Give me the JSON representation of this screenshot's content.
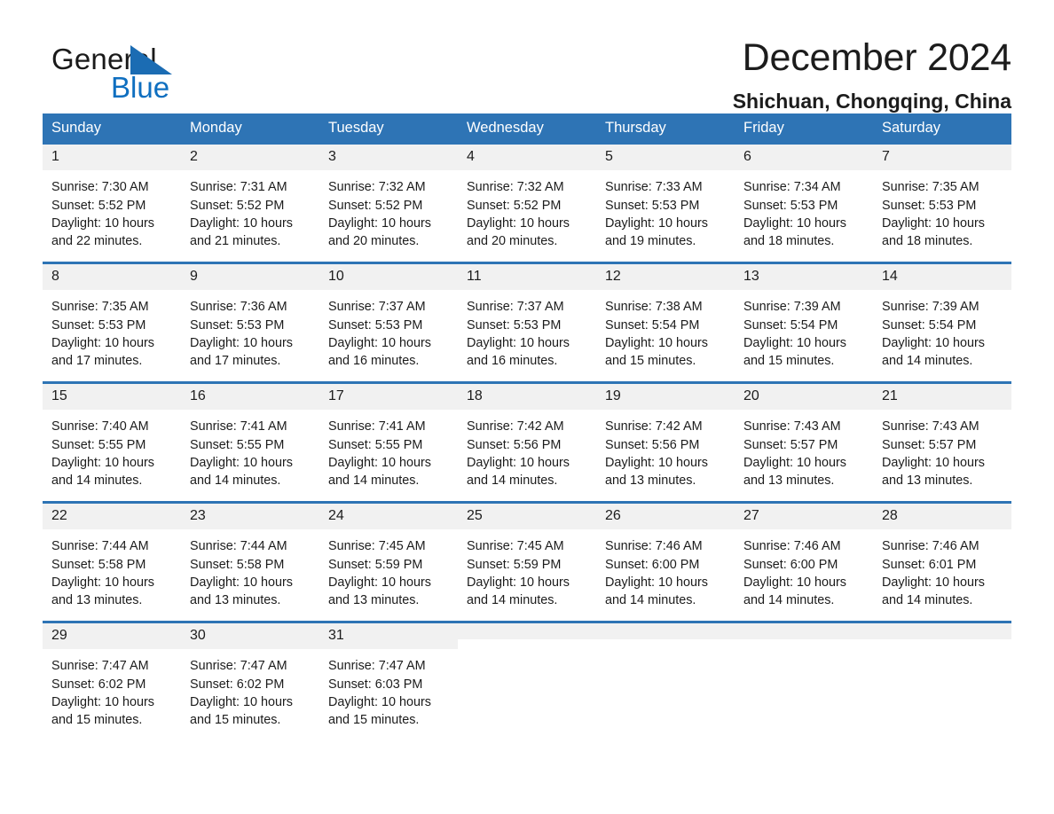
{
  "brand": {
    "name_part1": "General",
    "name_part2": "Blue",
    "triangle_color": "#1b6cb3",
    "blue_color": "#0f6fc0"
  },
  "header": {
    "title": "December 2024",
    "subtitle": "Shichuan, Chongqing, China"
  },
  "theme": {
    "header_bg": "#2e74b5",
    "daynum_bg": "#f1f1f1",
    "text": "#1c1c1c"
  },
  "weekday_headers": [
    "Sunday",
    "Monday",
    "Tuesday",
    "Wednesday",
    "Thursday",
    "Friday",
    "Saturday"
  ],
  "weeks": [
    [
      {
        "day": "1",
        "sunrise": "Sunrise: 7:30 AM",
        "sunset": "Sunset: 5:52 PM",
        "daylight1": "Daylight: 10 hours",
        "daylight2": "and 22 minutes."
      },
      {
        "day": "2",
        "sunrise": "Sunrise: 7:31 AM",
        "sunset": "Sunset: 5:52 PM",
        "daylight1": "Daylight: 10 hours",
        "daylight2": "and 21 minutes."
      },
      {
        "day": "3",
        "sunrise": "Sunrise: 7:32 AM",
        "sunset": "Sunset: 5:52 PM",
        "daylight1": "Daylight: 10 hours",
        "daylight2": "and 20 minutes."
      },
      {
        "day": "4",
        "sunrise": "Sunrise: 7:32 AM",
        "sunset": "Sunset: 5:52 PM",
        "daylight1": "Daylight: 10 hours",
        "daylight2": "and 20 minutes."
      },
      {
        "day": "5",
        "sunrise": "Sunrise: 7:33 AM",
        "sunset": "Sunset: 5:53 PM",
        "daylight1": "Daylight: 10 hours",
        "daylight2": "and 19 minutes."
      },
      {
        "day": "6",
        "sunrise": "Sunrise: 7:34 AM",
        "sunset": "Sunset: 5:53 PM",
        "daylight1": "Daylight: 10 hours",
        "daylight2": "and 18 minutes."
      },
      {
        "day": "7",
        "sunrise": "Sunrise: 7:35 AM",
        "sunset": "Sunset: 5:53 PM",
        "daylight1": "Daylight: 10 hours",
        "daylight2": "and 18 minutes."
      }
    ],
    [
      {
        "day": "8",
        "sunrise": "Sunrise: 7:35 AM",
        "sunset": "Sunset: 5:53 PM",
        "daylight1": "Daylight: 10 hours",
        "daylight2": "and 17 minutes."
      },
      {
        "day": "9",
        "sunrise": "Sunrise: 7:36 AM",
        "sunset": "Sunset: 5:53 PM",
        "daylight1": "Daylight: 10 hours",
        "daylight2": "and 17 minutes."
      },
      {
        "day": "10",
        "sunrise": "Sunrise: 7:37 AM",
        "sunset": "Sunset: 5:53 PM",
        "daylight1": "Daylight: 10 hours",
        "daylight2": "and 16 minutes."
      },
      {
        "day": "11",
        "sunrise": "Sunrise: 7:37 AM",
        "sunset": "Sunset: 5:53 PM",
        "daylight1": "Daylight: 10 hours",
        "daylight2": "and 16 minutes."
      },
      {
        "day": "12",
        "sunrise": "Sunrise: 7:38 AM",
        "sunset": "Sunset: 5:54 PM",
        "daylight1": "Daylight: 10 hours",
        "daylight2": "and 15 minutes."
      },
      {
        "day": "13",
        "sunrise": "Sunrise: 7:39 AM",
        "sunset": "Sunset: 5:54 PM",
        "daylight1": "Daylight: 10 hours",
        "daylight2": "and 15 minutes."
      },
      {
        "day": "14",
        "sunrise": "Sunrise: 7:39 AM",
        "sunset": "Sunset: 5:54 PM",
        "daylight1": "Daylight: 10 hours",
        "daylight2": "and 14 minutes."
      }
    ],
    [
      {
        "day": "15",
        "sunrise": "Sunrise: 7:40 AM",
        "sunset": "Sunset: 5:55 PM",
        "daylight1": "Daylight: 10 hours",
        "daylight2": "and 14 minutes."
      },
      {
        "day": "16",
        "sunrise": "Sunrise: 7:41 AM",
        "sunset": "Sunset: 5:55 PM",
        "daylight1": "Daylight: 10 hours",
        "daylight2": "and 14 minutes."
      },
      {
        "day": "17",
        "sunrise": "Sunrise: 7:41 AM",
        "sunset": "Sunset: 5:55 PM",
        "daylight1": "Daylight: 10 hours",
        "daylight2": "and 14 minutes."
      },
      {
        "day": "18",
        "sunrise": "Sunrise: 7:42 AM",
        "sunset": "Sunset: 5:56 PM",
        "daylight1": "Daylight: 10 hours",
        "daylight2": "and 14 minutes."
      },
      {
        "day": "19",
        "sunrise": "Sunrise: 7:42 AM",
        "sunset": "Sunset: 5:56 PM",
        "daylight1": "Daylight: 10 hours",
        "daylight2": "and 13 minutes."
      },
      {
        "day": "20",
        "sunrise": "Sunrise: 7:43 AM",
        "sunset": "Sunset: 5:57 PM",
        "daylight1": "Daylight: 10 hours",
        "daylight2": "and 13 minutes."
      },
      {
        "day": "21",
        "sunrise": "Sunrise: 7:43 AM",
        "sunset": "Sunset: 5:57 PM",
        "daylight1": "Daylight: 10 hours",
        "daylight2": "and 13 minutes."
      }
    ],
    [
      {
        "day": "22",
        "sunrise": "Sunrise: 7:44 AM",
        "sunset": "Sunset: 5:58 PM",
        "daylight1": "Daylight: 10 hours",
        "daylight2": "and 13 minutes."
      },
      {
        "day": "23",
        "sunrise": "Sunrise: 7:44 AM",
        "sunset": "Sunset: 5:58 PM",
        "daylight1": "Daylight: 10 hours",
        "daylight2": "and 13 minutes."
      },
      {
        "day": "24",
        "sunrise": "Sunrise: 7:45 AM",
        "sunset": "Sunset: 5:59 PM",
        "daylight1": "Daylight: 10 hours",
        "daylight2": "and 13 minutes."
      },
      {
        "day": "25",
        "sunrise": "Sunrise: 7:45 AM",
        "sunset": "Sunset: 5:59 PM",
        "daylight1": "Daylight: 10 hours",
        "daylight2": "and 14 minutes."
      },
      {
        "day": "26",
        "sunrise": "Sunrise: 7:46 AM",
        "sunset": "Sunset: 6:00 PM",
        "daylight1": "Daylight: 10 hours",
        "daylight2": "and 14 minutes."
      },
      {
        "day": "27",
        "sunrise": "Sunrise: 7:46 AM",
        "sunset": "Sunset: 6:00 PM",
        "daylight1": "Daylight: 10 hours",
        "daylight2": "and 14 minutes."
      },
      {
        "day": "28",
        "sunrise": "Sunrise: 7:46 AM",
        "sunset": "Sunset: 6:01 PM",
        "daylight1": "Daylight: 10 hours",
        "daylight2": "and 14 minutes."
      }
    ],
    [
      {
        "day": "29",
        "sunrise": "Sunrise: 7:47 AM",
        "sunset": "Sunset: 6:02 PM",
        "daylight1": "Daylight: 10 hours",
        "daylight2": "and 15 minutes."
      },
      {
        "day": "30",
        "sunrise": "Sunrise: 7:47 AM",
        "sunset": "Sunset: 6:02 PM",
        "daylight1": "Daylight: 10 hours",
        "daylight2": "and 15 minutes."
      },
      {
        "day": "31",
        "sunrise": "Sunrise: 7:47 AM",
        "sunset": "Sunset: 6:03 PM",
        "daylight1": "Daylight: 10 hours",
        "daylight2": "and 15 minutes."
      },
      {
        "day": "",
        "sunrise": "",
        "sunset": "",
        "daylight1": "",
        "daylight2": ""
      },
      {
        "day": "",
        "sunrise": "",
        "sunset": "",
        "daylight1": "",
        "daylight2": ""
      },
      {
        "day": "",
        "sunrise": "",
        "sunset": "",
        "daylight1": "",
        "daylight2": ""
      },
      {
        "day": "",
        "sunrise": "",
        "sunset": "",
        "daylight1": "",
        "daylight2": ""
      }
    ]
  ]
}
